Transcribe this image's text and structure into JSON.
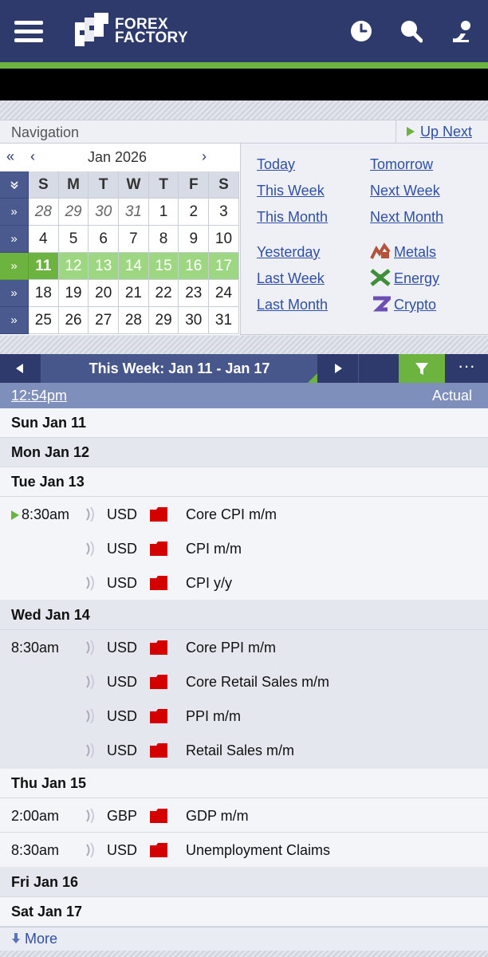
{
  "header": {
    "logo_line1": "FOREX",
    "logo_line2": "FACTORY",
    "icons": [
      "menu-icon",
      "clock-icon",
      "search-icon",
      "user-icon"
    ]
  },
  "navigation": {
    "title": "Navigation",
    "up_next": "Up Next"
  },
  "calendar": {
    "prev_year": "«",
    "prev_month": "‹",
    "month_label": "Jan 2026",
    "next_month": "›",
    "weekday_headers": [
      "S",
      "M",
      "T",
      "W",
      "T",
      "F",
      "S"
    ],
    "week_icon": "»",
    "weeks": [
      {
        "days": [
          "28",
          "29",
          "30",
          "31",
          "1",
          "2",
          "3"
        ]
      },
      {
        "days": [
          "4",
          "5",
          "6",
          "7",
          "8",
          "9",
          "10"
        ]
      },
      {
        "days": [
          "11",
          "12",
          "13",
          "14",
          "15",
          "16",
          "17"
        ]
      },
      {
        "days": [
          "18",
          "19",
          "20",
          "21",
          "22",
          "23",
          "24"
        ]
      },
      {
        "days": [
          "25",
          "26",
          "27",
          "28",
          "29",
          "30",
          "31"
        ]
      }
    ]
  },
  "quick_links": {
    "today": "Today",
    "tomorrow": "Tomorrow",
    "this_week": "This Week",
    "next_week": "Next Week",
    "this_month": "This Month",
    "next_month": "Next Month",
    "yesterday": "Yesterday",
    "last_week": "Last Week",
    "last_month": "Last Month",
    "metals": "Metals",
    "energy": "Energy",
    "crypto": "Crypto"
  },
  "week_bar": {
    "title": "This Week: Jan 11 - Jan 17",
    "more": "···"
  },
  "time_bar": {
    "time": "12:54pm",
    "actual": "Actual"
  },
  "colors": {
    "header": "#2d3a6b",
    "accent_green": "#6cb33f",
    "impact_high": "#d40000",
    "link": "#2f4fa8"
  },
  "schedule": {
    "sun": "Sun Jan 11",
    "mon": "Mon Jan 12",
    "tue": "Tue Jan 13",
    "tue_events": [
      {
        "time": "8:30am",
        "currency": "USD",
        "event": "Core CPI m/m"
      },
      {
        "time": "",
        "currency": "USD",
        "event": "CPI m/m"
      },
      {
        "time": "",
        "currency": "USD",
        "event": "CPI y/y"
      }
    ],
    "wed": "Wed Jan 14",
    "wed_events": [
      {
        "time": "8:30am",
        "currency": "USD",
        "event": "Core PPI m/m"
      },
      {
        "time": "",
        "currency": "USD",
        "event": "Core Retail Sales m/m"
      },
      {
        "time": "",
        "currency": "USD",
        "event": "PPI m/m"
      },
      {
        "time": "",
        "currency": "USD",
        "event": "Retail Sales m/m"
      }
    ],
    "thu": "Thu Jan 15",
    "thu_events": [
      {
        "time": "2:00am",
        "currency": "GBP",
        "event": "GDP m/m"
      },
      {
        "time": "8:30am",
        "currency": "USD",
        "event": "Unemployment Claims"
      }
    ],
    "fri": "Fri Jan 16",
    "sat": "Sat Jan 17"
  },
  "more": "More"
}
